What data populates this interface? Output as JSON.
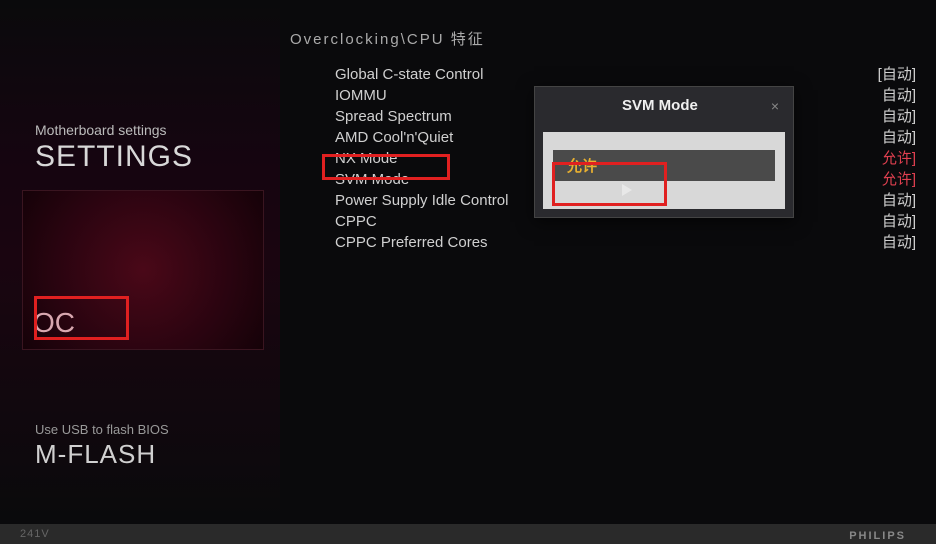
{
  "breadcrumb": "Overclocking\\CPU 特征",
  "sidebar": {
    "settings_label": "Motherboard settings",
    "settings_title": "SETTINGS",
    "oc_label": "OC",
    "mflash_label": "Use USB to flash BIOS",
    "mflash_title": "M-FLASH"
  },
  "settings": [
    {
      "label": "Global C-state Control",
      "value": "[自动]"
    },
    {
      "label": "IOMMU",
      "value": "自动]"
    },
    {
      "label": "Spread Spectrum",
      "value": "自动]"
    },
    {
      "label": "AMD Cool'n'Quiet",
      "value": "自动]"
    },
    {
      "label": "NX Mode",
      "value": "允许]"
    },
    {
      "label": "SVM Mode",
      "value": "允许]"
    },
    {
      "label": "Power Supply Idle Control",
      "value": "自动]"
    },
    {
      "label": "CPPC",
      "value": "自动]"
    },
    {
      "label": "CPPC Preferred Cores",
      "value": "自动]"
    }
  ],
  "popup": {
    "title": "SVM Mode",
    "close": "×",
    "option": "允许"
  },
  "bottom": {
    "power": "241V",
    "brand": "PHILIPS"
  }
}
